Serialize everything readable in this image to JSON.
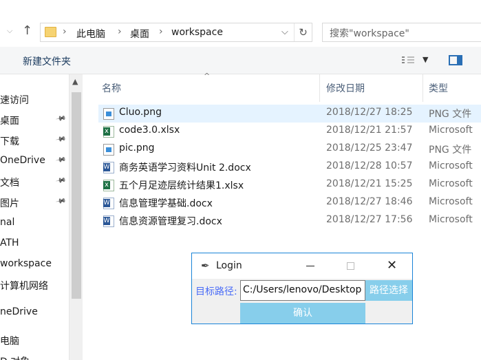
{
  "address": {
    "crumbs": [
      "此电脑",
      "桌面",
      "workspace"
    ],
    "search_placeholder": "搜索\"workspace\""
  },
  "toolbar": {
    "new_folder": "新建文件夹"
  },
  "sidebar": {
    "items": [
      {
        "label": "速访问",
        "pinned": false
      },
      {
        "label": "桌面",
        "pinned": true
      },
      {
        "label": "下载",
        "pinned": true
      },
      {
        "label": "OneDrive",
        "pinned": true
      },
      {
        "label": "文档",
        "pinned": true
      },
      {
        "label": "图片",
        "pinned": true
      },
      {
        "label": "nal",
        "pinned": false
      },
      {
        "label": "ATH",
        "pinned": false
      },
      {
        "label": "workspace",
        "pinned": false
      },
      {
        "label": "计算机网络",
        "pinned": false
      },
      {
        "label": "neDrive",
        "pinned": false
      },
      {
        "label": "电脑",
        "pinned": false
      },
      {
        "label": "D 对象",
        "pinned": false
      }
    ]
  },
  "columns": {
    "name": "名称",
    "date": "修改日期",
    "type": "类型"
  },
  "files": [
    {
      "name": "Cluo.png",
      "date": "2018/12/27 18:25",
      "type": "PNG 文件",
      "kind": "png",
      "selected": true
    },
    {
      "name": "code3.0.xlsx",
      "date": "2018/12/21 21:57",
      "type": "Microsoft",
      "kind": "xlsx",
      "selected": false
    },
    {
      "name": "pic.png",
      "date": "2018/12/25 23:47",
      "type": "PNG 文件",
      "kind": "png",
      "selected": false
    },
    {
      "name": "商务英语学习资料Unit 2.docx",
      "date": "2018/12/28 10:57",
      "type": "Microsoft",
      "kind": "docx",
      "selected": false
    },
    {
      "name": "五个月足迹层统计结果1.xlsx",
      "date": "2018/12/21 15:25",
      "type": "Microsoft",
      "kind": "xlsx",
      "selected": false
    },
    {
      "name": "信息管理学基础.docx",
      "date": "2018/12/27 18:46",
      "type": "Microsoft",
      "kind": "docx",
      "selected": false
    },
    {
      "name": "信息资源管理复习.docx",
      "date": "2018/12/27 17:56",
      "type": "Microsoft",
      "kind": "docx",
      "selected": false
    }
  ],
  "dialog": {
    "title": "Login",
    "path_label": "目标路径:",
    "path_value": "C:/Users/lenovo/Desktop",
    "choose_button": "路径选择",
    "ok_button": "确认"
  }
}
